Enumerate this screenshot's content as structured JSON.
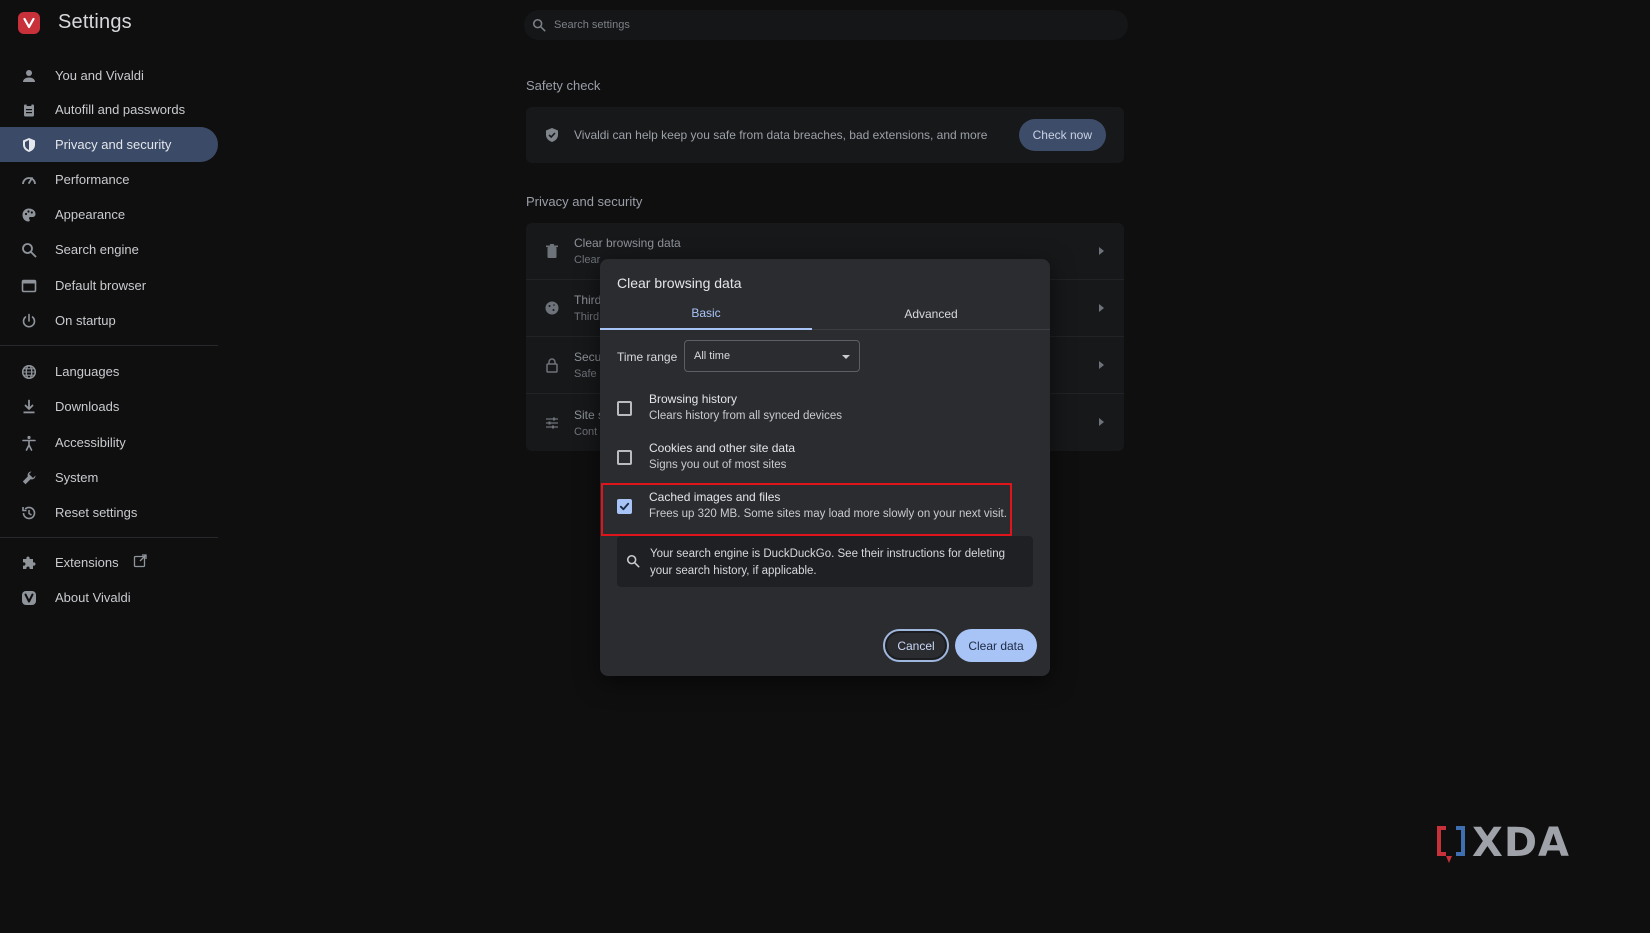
{
  "app": {
    "title": "Settings"
  },
  "search": {
    "placeholder": "Search settings"
  },
  "sidebar": {
    "items": [
      {
        "label": "You and Vivaldi",
        "icon": "person-icon"
      },
      {
        "label": "Autofill and passwords",
        "icon": "clipboard-icon"
      },
      {
        "label": "Privacy and security",
        "icon": "shield-icon",
        "active": true
      },
      {
        "label": "Performance",
        "icon": "gauge-icon"
      },
      {
        "label": "Appearance",
        "icon": "palette-icon"
      },
      {
        "label": "Search engine",
        "icon": "search-icon"
      },
      {
        "label": "Default browser",
        "icon": "browser-window-icon"
      },
      {
        "label": "On startup",
        "icon": "power-icon"
      },
      {
        "label": "Languages",
        "icon": "globe-icon"
      },
      {
        "label": "Downloads",
        "icon": "download-icon"
      },
      {
        "label": "Accessibility",
        "icon": "accessibility-icon"
      },
      {
        "label": "System",
        "icon": "wrench-icon"
      },
      {
        "label": "Reset settings",
        "icon": "history-icon"
      },
      {
        "label": "Extensions",
        "icon": "puzzle-icon"
      },
      {
        "label": "About Vivaldi",
        "icon": "vivaldi-logo-icon"
      }
    ]
  },
  "safety": {
    "section_title": "Safety check",
    "text": "Vivaldi can help keep you safe from data breaches, bad extensions, and more",
    "button": "Check now"
  },
  "privacy": {
    "section_title": "Privacy and security",
    "rows": [
      {
        "title": "Clear browsing data",
        "sub": "Clear",
        "icon": "trash-icon"
      },
      {
        "title": "Third",
        "sub": "Third",
        "icon": "cookie-icon"
      },
      {
        "title": "Secu",
        "sub": "Safe",
        "icon": "lock-icon"
      },
      {
        "title": "Site s",
        "sub": "Cont",
        "icon": "sliders-icon"
      }
    ]
  },
  "dialog": {
    "title": "Clear browsing data",
    "tabs": {
      "basic": "Basic",
      "advanced": "Advanced",
      "active": "Basic"
    },
    "time_range": {
      "label": "Time range",
      "value": "All time"
    },
    "options": [
      {
        "title": "Browsing history",
        "sub": "Clears history from all synced devices",
        "checked": false
      },
      {
        "title": "Cookies and other site data",
        "sub": "Signs you out of most sites",
        "checked": false
      },
      {
        "title": "Cached images and files",
        "sub": "Frees up 320 MB. Some sites may load more slowly on your next visit.",
        "checked": true
      }
    ],
    "info": "Your search engine is DuckDuckGo. See their instructions for deleting your search history, if applicable.",
    "cancel": "Cancel",
    "clear": "Clear data"
  },
  "watermark": {
    "text": "XDA"
  },
  "colors": {
    "background": "#0f0f10",
    "accent": "#a8c4f6",
    "active_nav": "#3b4a66",
    "highlight": "#e0141b",
    "brand_red": "#c8303a"
  }
}
